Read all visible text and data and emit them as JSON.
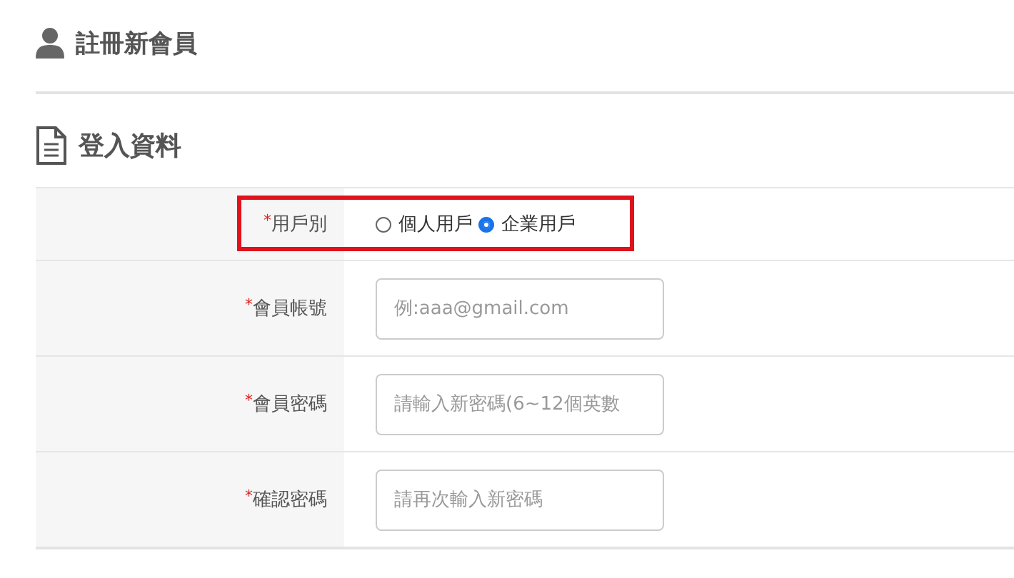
{
  "page_title": "註冊新會員",
  "section_title": "登入資料",
  "rows": [
    {
      "kind": "radio",
      "label": "用戶別",
      "required_mark": "*",
      "highlighted": true,
      "options": [
        {
          "label": "個人用戶",
          "selected": false
        },
        {
          "label": "企業用戶",
          "selected": true
        }
      ]
    },
    {
      "kind": "field",
      "label": "會員帳號",
      "required_mark": "*",
      "placeholder": "例:aaa@gmail.com"
    },
    {
      "kind": "field",
      "label": "會員密碼",
      "required_mark": "*",
      "placeholder": "請輸入新密碼(6~12個英數"
    },
    {
      "kind": "field",
      "label": "確認密碼",
      "required_mark": "*",
      "placeholder": "請再次輸入新密碼"
    }
  ]
}
